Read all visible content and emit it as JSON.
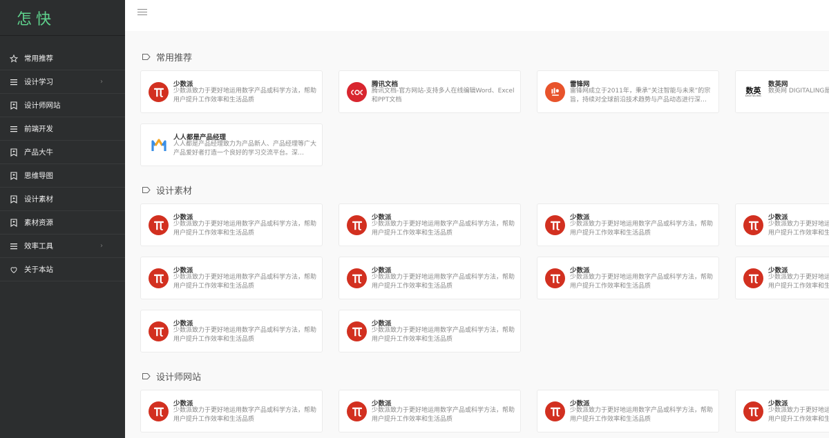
{
  "brand": {
    "logo_text": "怎快",
    "accent": "#5fd38d",
    "sidebar_bg": "#2c2e2f"
  },
  "sidebar": {
    "items": [
      {
        "label": "常用推荐",
        "icon": "star-icon",
        "has_children": false
      },
      {
        "label": "设计学习",
        "icon": "list-icon",
        "has_children": true
      },
      {
        "label": "设计师网站",
        "icon": "bookmark-icon",
        "has_children": false
      },
      {
        "label": "前端开发",
        "icon": "list-icon",
        "has_children": false
      },
      {
        "label": "产品大牛",
        "icon": "bookmark-icon",
        "has_children": false
      },
      {
        "label": "思维导图",
        "icon": "bookmark-icon",
        "has_children": false
      },
      {
        "label": "设计素材",
        "icon": "bookmark-icon",
        "has_children": false
      },
      {
        "label": "素材资源",
        "icon": "bookmark-icon",
        "has_children": false
      },
      {
        "label": "效率工具",
        "icon": "list-icon",
        "has_children": true
      },
      {
        "label": "关于本站",
        "icon": "heart-icon",
        "has_children": false
      }
    ]
  },
  "sections": [
    {
      "title": "常用推荐",
      "cards": [
        {
          "title": "少数派",
          "desc": "少数派致力于更好地运用数字产品或科学方法，帮助用户提升工作效率和生活品质",
          "logo": "sspai-logo"
        },
        {
          "title": "腾讯文档",
          "desc": "腾讯文档-官方网站-支持多人在线编辑Word、Excel和PPT文档",
          "logo": "tencent-docs-logo"
        },
        {
          "title": "雷锋网",
          "desc": "雷锋网成立于2011年，秉承“关注智能与未来”的宗旨，持续对全球前沿技术趋势与产品动态进行深…",
          "logo": "leiphone-logo"
        },
        {
          "title": "数英网",
          "desc": "数英网 DIGITALING是聘社交平台,内容涵盖",
          "logo": "digitaling-logo",
          "logo_text": "数英",
          "logo_subtext": "DIGITALING"
        },
        {
          "title": "人人都是产品经理",
          "desc": "人人都是产品经理致力为产品新人、产品经理等广大产品爱好者打造一个良好的学习交流平台。深…",
          "logo": "woshipm-logo"
        }
      ]
    },
    {
      "title": "设计素材",
      "cards": [
        {
          "title": "少数派",
          "desc": "少数派致力于更好地运用数字产品或科学方法，帮助用户提升工作效率和生活品质",
          "logo": "sspai-logo"
        },
        {
          "title": "少数派",
          "desc": "少数派致力于更好地运用数字产品或科学方法，帮助用户提升工作效率和生活品质",
          "logo": "sspai-logo"
        },
        {
          "title": "少数派",
          "desc": "少数派致力于更好地运用数字产品或科学方法，帮助用户提升工作效率和生活品质",
          "logo": "sspai-logo"
        },
        {
          "title": "少数派",
          "desc": "少数派致力于更好地运用数字产品或科学方法，帮助用户提升工作效率和生活品质",
          "logo": "sspai-logo"
        },
        {
          "title": "少数派",
          "desc": "少数派致力于更好地运用数字产品或科学方法，帮助用户提升工作效率和生活品质",
          "logo": "sspai-logo"
        },
        {
          "title": "少数派",
          "desc": "少数派致力于更好地运用数字产品或科学方法，帮助用户提升工作效率和生活品质",
          "logo": "sspai-logo"
        },
        {
          "title": "少数派",
          "desc": "少数派致力于更好地运用数字产品或科学方法，帮助用户提升工作效率和生活品质",
          "logo": "sspai-logo"
        },
        {
          "title": "少数派",
          "desc": "少数派致力于更好地运用数字产品或科学方法，帮助用户提升工作效率和生活品质",
          "logo": "sspai-logo"
        },
        {
          "title": "少数派",
          "desc": "少数派致力于更好地运用数字产品或科学方法，帮助用户提升工作效率和生活品质",
          "logo": "sspai-logo"
        },
        {
          "title": "少数派",
          "desc": "少数派致力于更好地运用数字产品或科学方法，帮助用户提升工作效率和生活品质",
          "logo": "sspai-logo"
        }
      ]
    },
    {
      "title": "设计师网站",
      "cards": [
        {
          "title": "少数派",
          "desc": "少数派致力于更好地运用数字产品或科学方法，帮助用户提升工作效率和生活品质",
          "logo": "sspai-logo"
        },
        {
          "title": "少数派",
          "desc": "少数派致力于更好地运用数字产品或科学方法，帮助用户提升工作效率和生活品质",
          "logo": "sspai-logo"
        },
        {
          "title": "少数派",
          "desc": "少数派致力于更好地运用数字产品或科学方法，帮助用户提升工作效率和生活品质",
          "logo": "sspai-logo"
        },
        {
          "title": "少数派",
          "desc": "少数派致力于更好地运用数字产品或科学方法，帮助用户提升工作效率和生活品质",
          "logo": "sspai-logo"
        }
      ]
    }
  ]
}
